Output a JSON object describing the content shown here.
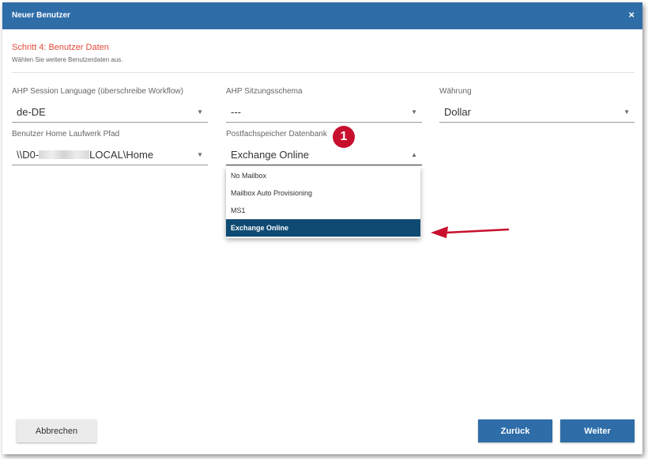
{
  "dialog": {
    "title": "Neuer Benutzer",
    "close_label": "×"
  },
  "step": {
    "title": "Schritt 4: Benutzer Daten",
    "subtitle": "Wählen Sie weitere Benutzerdaten aus."
  },
  "fields": {
    "session_language": {
      "label": "AHP Session Language (überschreibe Workflow)",
      "value": "de-DE"
    },
    "sitzungsschema": {
      "label": "AHP Sitzungsschema",
      "value": "---"
    },
    "waehrung": {
      "label": "Währung",
      "value": "Dollar"
    },
    "home_path": {
      "label": "Benutzer Home Laufwerk Pfad",
      "value_prefix": "\\\\D0-",
      "value_suffix": "LOCAL\\Home"
    },
    "postfach": {
      "label": "Postfachspeicher Datenbank",
      "value": "Exchange Online"
    }
  },
  "dropdown": {
    "options": [
      "No Mailbox",
      "Mailbox Auto Provisioning",
      "MS1",
      "Exchange Online"
    ],
    "selected": "Exchange Online"
  },
  "annotation": {
    "badge": "1"
  },
  "buttons": {
    "cancel": "Abbrechen",
    "back": "Zurück",
    "next": "Weiter"
  },
  "colors": {
    "titlebar": "#2e6da8",
    "step_title": "#e64a3c",
    "option_selected": "#0f4a73",
    "badge": "#c8102e",
    "annotation_arrow": "#c8102e"
  }
}
